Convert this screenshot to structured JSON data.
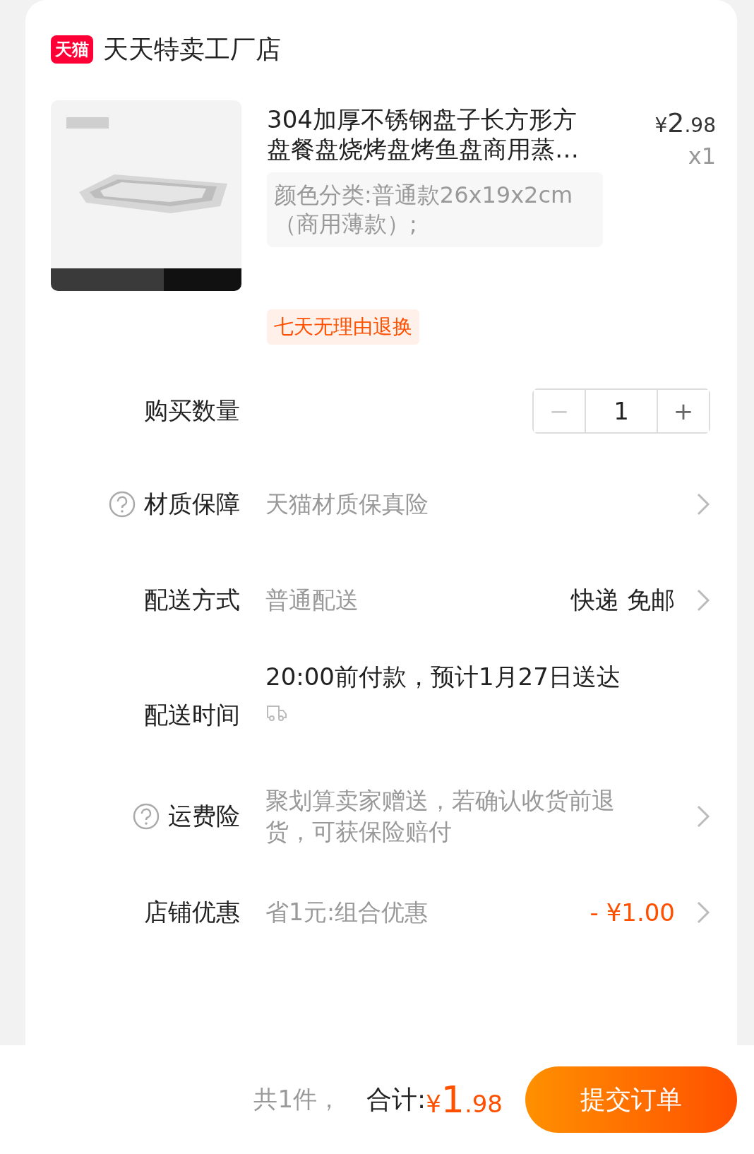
{
  "store": {
    "badge": "天猫",
    "name": "天天特卖工厂店"
  },
  "product": {
    "title": "304加厚不锈钢盘子长方形方盘餐盘烧烤盘烤鱼盘商用蒸…",
    "price_symbol": "¥",
    "price_int": "2",
    "price_dec": ".98",
    "quantity": "x1",
    "spec": "颜色分类:普通款26x19x2cm（商用薄款）;",
    "tag": "七天无理由退换"
  },
  "rows": [
    {
      "kind": "quantity",
      "label": "购买数量",
      "help": false,
      "minus": "−",
      "value": "1",
      "plus": "+",
      "minus_disabled": true
    },
    {
      "kind": "option",
      "label": "材质保障",
      "help": true,
      "value": "天猫材质保真险"
    },
    {
      "kind": "option",
      "label": "配送方式",
      "help": false,
      "value": "普通配送",
      "detail": "快递 免邮",
      "detail_accent": false
    },
    {
      "kind": "schedule",
      "label": "配送时间",
      "help": false,
      "value": "20:00前付款，预计1月27日送达"
    },
    {
      "kind": "option",
      "label": "运费险",
      "help": true,
      "value": "聚划算卖家赠送，若确认收货前退货，可获保险赔付"
    },
    {
      "kind": "option",
      "label": "店铺优惠",
      "help": false,
      "value": "省1元:组合优惠",
      "detail": "- ¥1.00",
      "detail_accent": true
    }
  ],
  "footer": {
    "count": "共1件，",
    "total_label": "合计:",
    "total_symbol": "¥",
    "total_int": "1",
    "total_dec": ".98",
    "submit": "提交订单"
  }
}
